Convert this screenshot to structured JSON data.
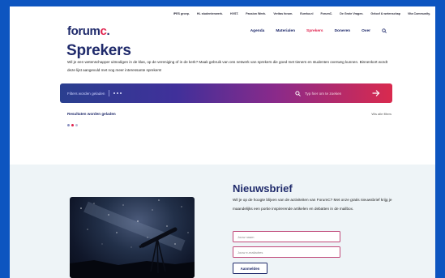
{
  "topbar": [
    "IPES groep.",
    "HL studentenwerk.",
    "HVST.",
    "Passion Week.",
    "Veritas forum.",
    "Eureka.nl",
    "ForumC.",
    "De Grote Vragen.",
    "Geloof & wetenschap",
    "Vita Community."
  ],
  "header": {
    "logo_prefix": "forum",
    "logo_accent": "c",
    "logo_suffix": ".",
    "nav": [
      {
        "label": "Agenda",
        "active": false
      },
      {
        "label": "Materialen",
        "active": false
      },
      {
        "label": "Sprekers",
        "active": true
      },
      {
        "label": "Doneren",
        "active": false
      },
      {
        "label": "Over",
        "active": false
      }
    ],
    "search_icon": "search-icon"
  },
  "main": {
    "title": "Sprekers",
    "intro": "Wil je een wetenschapper uitnodigen in de klas, op de vereniging of in de kerk? Maak gebruik van ons netwerk van sprekers die goed met tieners en studenten overweg kunnen. Binnenkort wordt deze lijst aangevuld met nog meer interessante sprekers!"
  },
  "filterbar": {
    "label": "Filters worden geladen",
    "search_placeholder": "Typ hier om te zoeken",
    "submit_icon": "arrow-right-icon"
  },
  "results": {
    "label": "Resultaten worden geladen",
    "view_all": "Wis alle filters"
  },
  "newsletter": {
    "title": "Nieuwsbrief",
    "text": "Wil je op de hoogte blijven van de activiteiten van ForumC? Met onze gratis nieuwsbrief krijg je maandelijks een portie inspirerende artikelen en debatten in de mailbox.",
    "name_placeholder": "Jouw naam",
    "email_placeholder": "Jouw e-mailadres",
    "submit_label": "Aanmelden",
    "image_icon": "telescope-image"
  },
  "colors": {
    "page_frame": "#0d55c0",
    "navy": "#1f2a6b",
    "accent": "#e0224e",
    "band": "#eef4f7"
  }
}
